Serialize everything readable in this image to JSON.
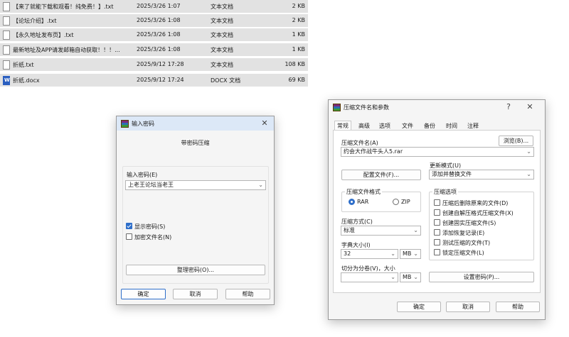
{
  "files": [
    {
      "name": "【来了就能下载和观看！纯免费！】.txt",
      "date": "2025/3/26 1:07",
      "type": "文本文档",
      "size": "2 KB",
      "icon": "txt-file-icon"
    },
    {
      "name": "【论坛介绍】.txt",
      "date": "2025/3/26 1:08",
      "type": "文本文档",
      "size": "2 KB",
      "icon": "txt-file-icon"
    },
    {
      "name": "【永久地址发布页】.txt",
      "date": "2025/3/26 1:08",
      "type": "文本文档",
      "size": "1 KB",
      "icon": "txt-file-icon"
    },
    {
      "name": "最新地址及APP请发邮箱自动获取！！！...",
      "date": "2025/3/26 1:08",
      "type": "文本文档",
      "size": "1 KB",
      "icon": "txt-file-icon"
    },
    {
      "name": "折纸.txt",
      "date": "2025/9/12 17:28",
      "type": "文本文档",
      "size": "108 KB",
      "icon": "txt-file-icon"
    },
    {
      "name": "折纸.docx",
      "date": "2025/9/12 17:24",
      "type": "DOCX 文档",
      "size": "69 KB",
      "icon": "docx-file-icon"
    }
  ],
  "password_dialog": {
    "title": "输入密码",
    "heading": "带密码压缩",
    "password_label": "输入密码(E)",
    "password_value": "上老王论坛当老王",
    "show_password": {
      "label": "显示密码(S)",
      "checked": true
    },
    "encrypt_names": {
      "label": "加密文件名(N)",
      "checked": false
    },
    "organize_button": "整理密码(O)...",
    "ok": "确定",
    "cancel": "取消",
    "help": "帮助"
  },
  "archive_dialog": {
    "title": "压缩文件名和参数",
    "help_glyph": "?",
    "tabs": [
      "常规",
      "高级",
      "选项",
      "文件",
      "备份",
      "时间",
      "注释"
    ],
    "archive_name_label": "压缩文件名(A)",
    "browse_button": "浏览(B)...",
    "archive_name_value": "约会大作战牛头人5.rar",
    "profiles_button": "配置文件(F)...",
    "update_mode_label": "更新模式(U)",
    "update_mode_value": "添加并替换文件",
    "format_group": "压缩文件格式",
    "format_rar": "RAR",
    "format_zip": "ZIP",
    "method_label": "压缩方式(C)",
    "method_value": "标准",
    "dict_label": "字典大小(I)",
    "dict_value": "32",
    "dict_unit": "MB",
    "split_label": "切分为分卷(V)，大小",
    "split_value": "",
    "split_unit": "MB",
    "options_group": "压缩选项",
    "options": [
      {
        "label": "压缩后删除原来的文件(D)",
        "checked": false
      },
      {
        "label": "创建自解压格式压缩文件(X)",
        "checked": false
      },
      {
        "label": "创建固实压缩文件(S)",
        "checked": false
      },
      {
        "label": "添加恢复记录(E)",
        "checked": false
      },
      {
        "label": "测试压缩的文件(T)",
        "checked": false
      },
      {
        "label": "锁定压缩文件(L)",
        "checked": false
      }
    ],
    "set_password_button": "设置密码(P)...",
    "ok": "确定",
    "cancel": "取消",
    "help": "帮助"
  },
  "colors": {
    "accent": "#2f6fca",
    "row_bg": "#e2e2e2",
    "titlebar_active": "#dce8f7"
  }
}
